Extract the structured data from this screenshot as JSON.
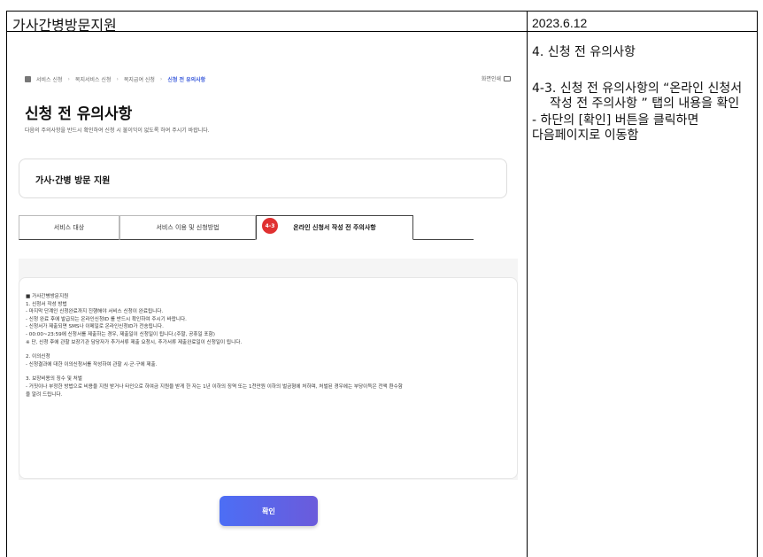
{
  "header": {
    "title": "가사간병방문지원",
    "date": "2023.6.12"
  },
  "notes": {
    "section": "4. 신청 전 유의사항",
    "step": "4-3. 신청 전 유의사항의 “온라인 신청서 작성 전 주의사항 ” 탭의 내용을 확인",
    "extra1": " - 하단의 [확인] 버튼을 클릭하면",
    "extra2": "다음페이지로 이동함"
  },
  "screen": {
    "breadcrumb": [
      "서비스 신청",
      "복지서비스 신청",
      "복지급여 신청",
      "신청 전 유의사항"
    ],
    "print_label": "화면인쇄",
    "page_title": "신청 전 유의사항",
    "page_desc": "다음의 주의사항을 반드시 확인하여 신청 시 불이익이 없도록 하여 주시기 바랍니다.",
    "service_name": "가사·간병 방문 지원",
    "tabs": [
      {
        "label": "서비스 대상"
      },
      {
        "label": "서비스 이용 및 신청방법"
      },
      {
        "label": "온라인 신청서 작성 전 주의사항",
        "badge": "4-3"
      }
    ],
    "notice_lines": [
      "■ 가사간병방문지원",
      "1. 신청서 작성 방법",
      " - 마지막 단계인 신청완료까지 진행해야 서비스 신청이 완료됩니다.",
      " - 신청 완료 후에 발급되는 온라인신청ID 를 반드시 확인하여 주시기 바랍니다.",
      " - 신청서가 제출되면 SMS나 이메일로 온라인신청ID가 전송됩니다.",
      " - 00:00~23:59에 신청서를 제출하는 경우, 제출일이 신청일이 됩니다.(주말, 공휴일 포함)",
      "   ※ 단, 신청 후에 관할 보장기관 담당자가 추가서류 제출 요청시, 추가서류 제출완료일이 신청일이 됩니다.",
      "",
      "2. 이의신청",
      " - 신청결과에 대한 이의신청서를 작성하여 관할 시·군·구에 제출.",
      "",
      "3. 보장비용의 징수 및 처벌",
      " - 거짓이나 부정한 방법으로 비용을 지원 받거나 타인으로 하여금 지원을 받게 한 자는 1년 이하의 징역 또는 1천만원 이하의 벌금형에 처하며, 처벌된 경우에는 부당이득은 전액 환수함",
      "   을 알려 드립니다."
    ],
    "confirm_label": "확인"
  }
}
